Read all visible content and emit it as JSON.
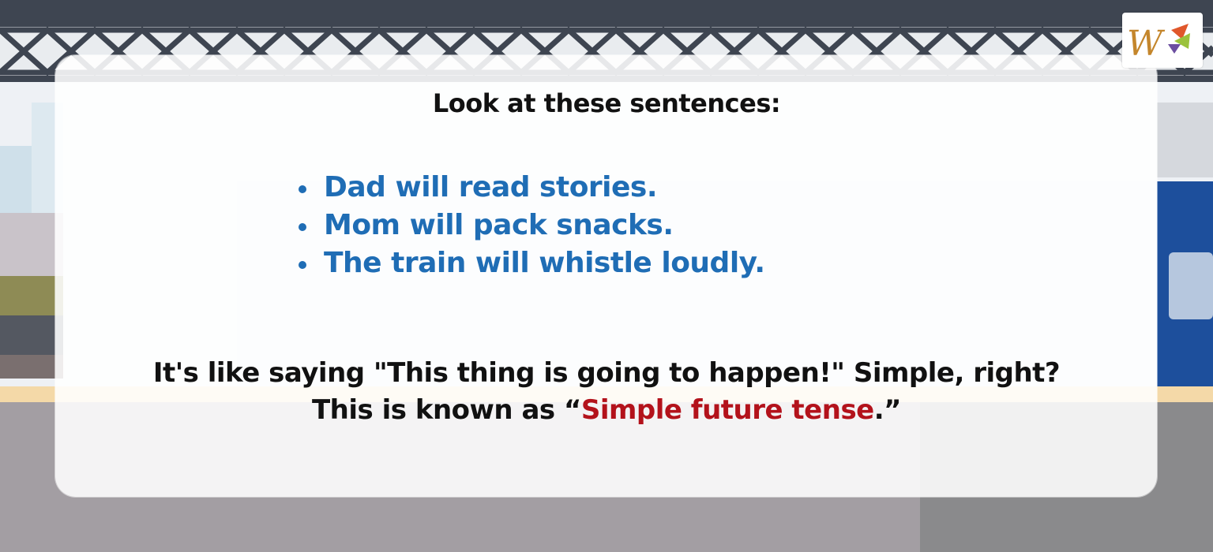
{
  "heading": "Look at these sentences:",
  "examples": [
    "Dad will read stories.",
    "Mom will pack snacks.",
    "The train will whistle loudly."
  ],
  "explanation": {
    "line1": "It's like saying \"This thing is going to happen!\" Simple, right?",
    "line2_prefix": "This is known as “",
    "line2_highlight": "Simple future tense",
    "line2_suffix": ".”"
  },
  "colors": {
    "example_text": "#1f6db5",
    "highlight": "#b3121b",
    "heading": "#111111"
  },
  "logo_icon": "w-brand-logo-icon"
}
